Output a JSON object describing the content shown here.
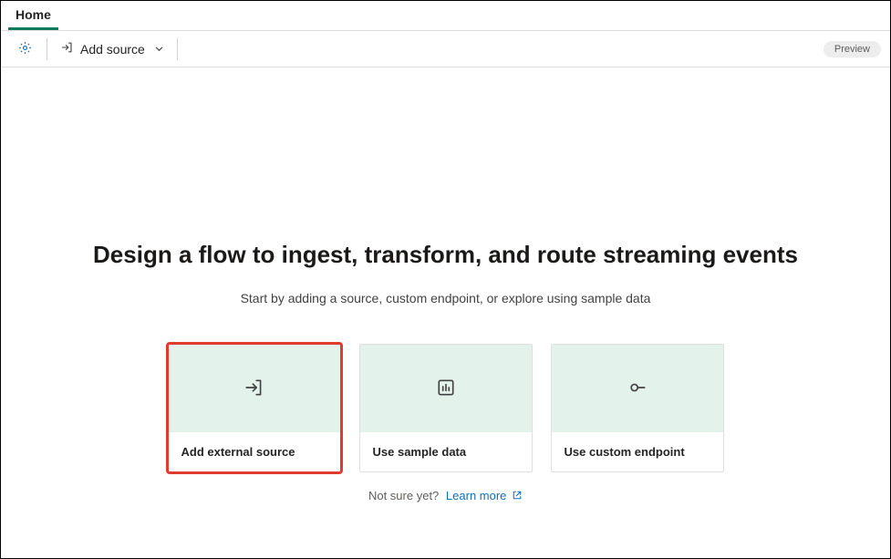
{
  "tabs": {
    "home": "Home"
  },
  "toolbar": {
    "add_source_label": "Add source",
    "preview_badge": "Preview"
  },
  "hero": {
    "title": "Design a flow to ingest, transform, and route streaming events",
    "subtitle": "Start by adding a source, custom endpoint, or explore using sample data"
  },
  "cards": {
    "external_source": "Add external source",
    "sample_data": "Use sample data",
    "custom_endpoint": "Use custom endpoint"
  },
  "footer": {
    "not_sure": "Not sure yet?",
    "learn_more": "Learn more"
  }
}
